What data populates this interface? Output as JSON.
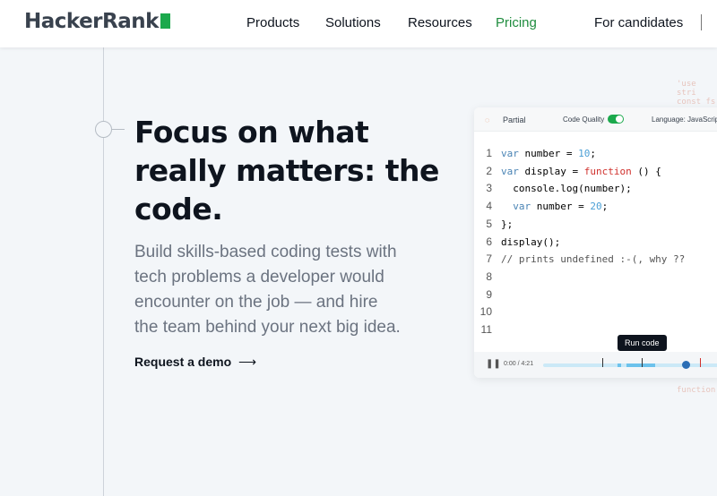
{
  "nav": {
    "logo": "HackerRank",
    "items": [
      "Products",
      "Solutions",
      "Resources",
      "Pricing",
      "For candidates"
    ],
    "accent": "#1ba94c"
  },
  "hero": {
    "title": "Focus on what really matters: the code.",
    "subtitle": "Build skills-based coding tests with tech problems a developer would encounter on the job — and hire the team behind your next big idea.",
    "cta": "Request a demo",
    "cta_arrow": "⟶"
  },
  "bg_code": [
    "'use stri",
    "const fs",
    "function"
  ],
  "editor": {
    "status": "Partial",
    "code_quality_label": "Code Quality",
    "code_quality_on": true,
    "language": "Language:  JavaScript",
    "lines": [
      "1",
      "2",
      "3",
      "4",
      "5",
      "6",
      "7",
      "8",
      "9",
      "10",
      "11"
    ],
    "time": "0:00 / 4:21",
    "tooltip": "Run code"
  }
}
